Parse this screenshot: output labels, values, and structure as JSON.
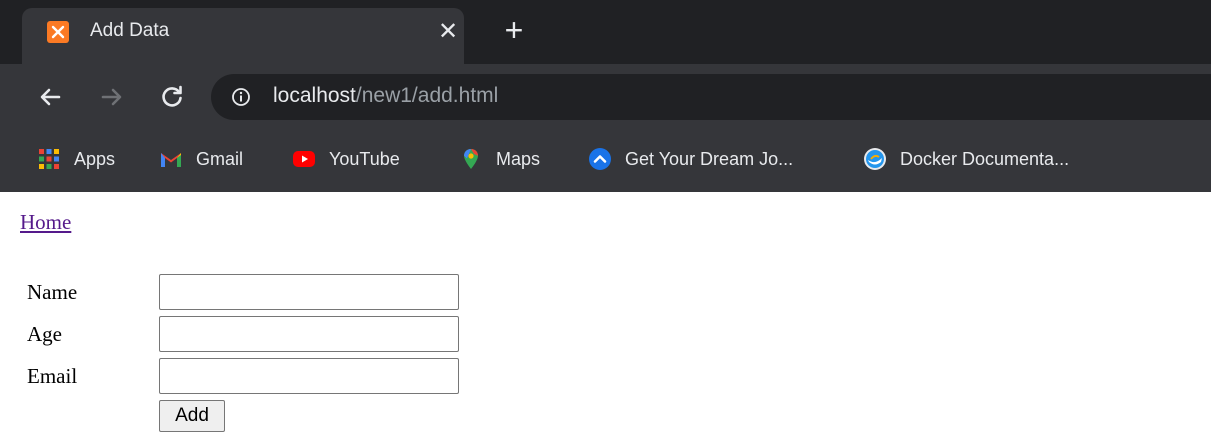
{
  "tab": {
    "title": "Add Data",
    "close_glyph": "✕",
    "new_tab_glyph": "+",
    "favicon": "xampp-icon",
    "favicon_color": "#fb7a24"
  },
  "nav": {
    "back": "arrow-left-icon",
    "forward": "arrow-right-icon",
    "reload": "reload-icon"
  },
  "address": {
    "host": "localhost",
    "path": "/new1/add.html",
    "info_icon": "info-icon"
  },
  "bookmarks": [
    {
      "label": "Apps",
      "icon": "apps-grid-icon"
    },
    {
      "label": "Gmail",
      "icon": "gmail-icon"
    },
    {
      "label": "YouTube",
      "icon": "youtube-icon"
    },
    {
      "label": "Maps",
      "icon": "maps-icon"
    },
    {
      "label": "Get Your Dream Jo...",
      "icon": "dream-job-icon"
    },
    {
      "label": "Docker Documenta...",
      "icon": "docker-icon"
    }
  ],
  "page": {
    "home_link": "Home",
    "fields": [
      {
        "label": "Name",
        "value": ""
      },
      {
        "label": "Age",
        "value": ""
      },
      {
        "label": "Email",
        "value": ""
      }
    ],
    "submit_label": "Add"
  },
  "colors": {
    "chrome_dark": "#202124",
    "chrome_toolbar": "#35363a",
    "link_visited": "#551a8b"
  }
}
